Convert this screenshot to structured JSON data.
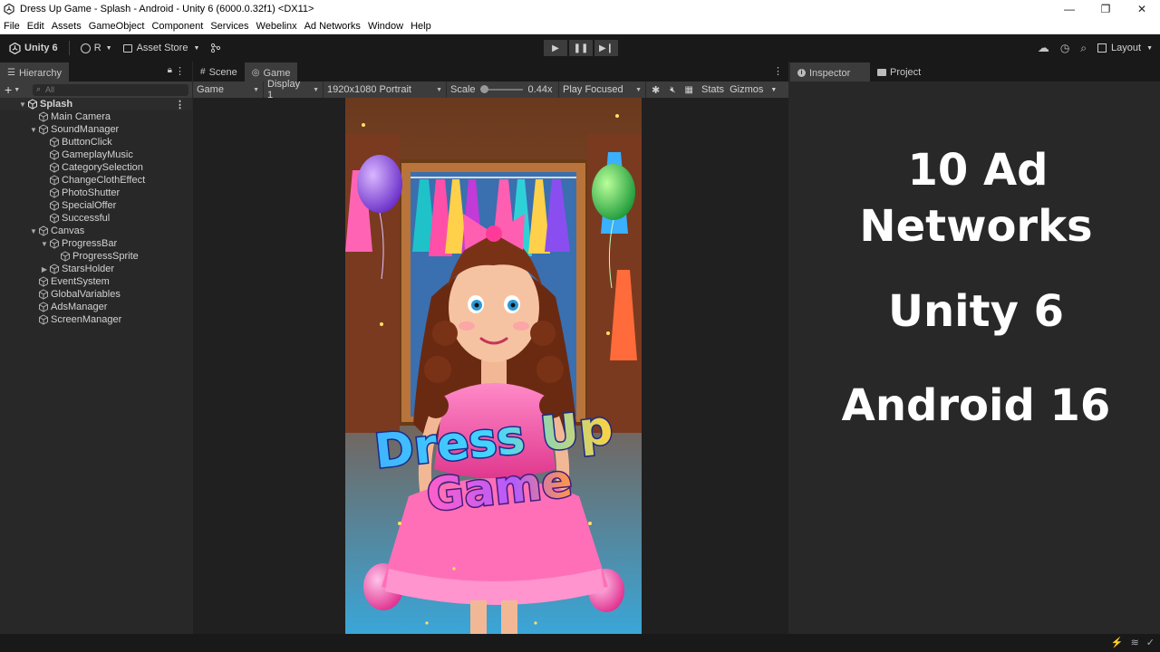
{
  "window": {
    "title": "Dress Up Game - Splash - Android - Unity 6 (6000.0.32f1) <DX11>",
    "controls": [
      "—",
      "❐",
      "✕"
    ]
  },
  "menu": [
    "File",
    "Edit",
    "Assets",
    "GameObject",
    "Component",
    "Services",
    "Webelinx",
    "Ad Networks",
    "Window",
    "Help"
  ],
  "toolbar": {
    "unity_label": "Unity 6",
    "account_label": "R",
    "asset_store_label": "Asset Store",
    "layout_label": "Layout"
  },
  "hierarchy": {
    "tab_label": "Hierarchy",
    "search_placeholder": "All",
    "rows": [
      {
        "label": "Splash",
        "depth": 0,
        "arrow": "▼",
        "root": true
      },
      {
        "label": "Main Camera",
        "depth": 1,
        "arrow": ""
      },
      {
        "label": "SoundManager",
        "depth": 1,
        "arrow": "▼"
      },
      {
        "label": "ButtonClick",
        "depth": 2,
        "arrow": ""
      },
      {
        "label": "GameplayMusic",
        "depth": 2,
        "arrow": ""
      },
      {
        "label": "CategorySelection",
        "depth": 2,
        "arrow": ""
      },
      {
        "label": "ChangeClothEffect",
        "depth": 2,
        "arrow": ""
      },
      {
        "label": "PhotoShutter",
        "depth": 2,
        "arrow": ""
      },
      {
        "label": "SpecialOffer",
        "depth": 2,
        "arrow": ""
      },
      {
        "label": "Successful",
        "depth": 2,
        "arrow": ""
      },
      {
        "label": "Canvas",
        "depth": 1,
        "arrow": "▼"
      },
      {
        "label": "ProgressBar",
        "depth": 2,
        "arrow": "▼"
      },
      {
        "label": "ProgressSprite",
        "depth": 3,
        "arrow": ""
      },
      {
        "label": "StarsHolder",
        "depth": 2,
        "arrow": "▶"
      },
      {
        "label": "EventSystem",
        "depth": 1,
        "arrow": ""
      },
      {
        "label": "GlobalVariables",
        "depth": 1,
        "arrow": ""
      },
      {
        "label": "AdsManager",
        "depth": 1,
        "arrow": ""
      },
      {
        "label": "ScreenManager",
        "depth": 1,
        "arrow": ""
      }
    ]
  },
  "game_panel": {
    "tabs": [
      "Scene",
      "Game"
    ],
    "active_tab": "Game",
    "view_mode": "Game",
    "display": "Display 1",
    "resolution": "1920x1080 Portrait",
    "scale_label": "Scale",
    "scale_value": "0.44x",
    "play_mode": "Play Focused",
    "stats_label": "Stats",
    "gizmos_label": "Gizmos"
  },
  "game_art": {
    "logo_line1": "Dress Up",
    "logo_line2": "Game"
  },
  "inspector": {
    "tabs": [
      "Inspector",
      "Project"
    ],
    "overlay_lines": [
      "10 Ad",
      "Networks",
      "Unity 6",
      "Android 16"
    ]
  },
  "colors": {
    "editor_bg": "#282828",
    "toolbar_bg": "#191919",
    "logo_blue": "#3fb4ff",
    "logo_pink": "#ff5fc8",
    "dress_pink": "#ff6fb8"
  }
}
